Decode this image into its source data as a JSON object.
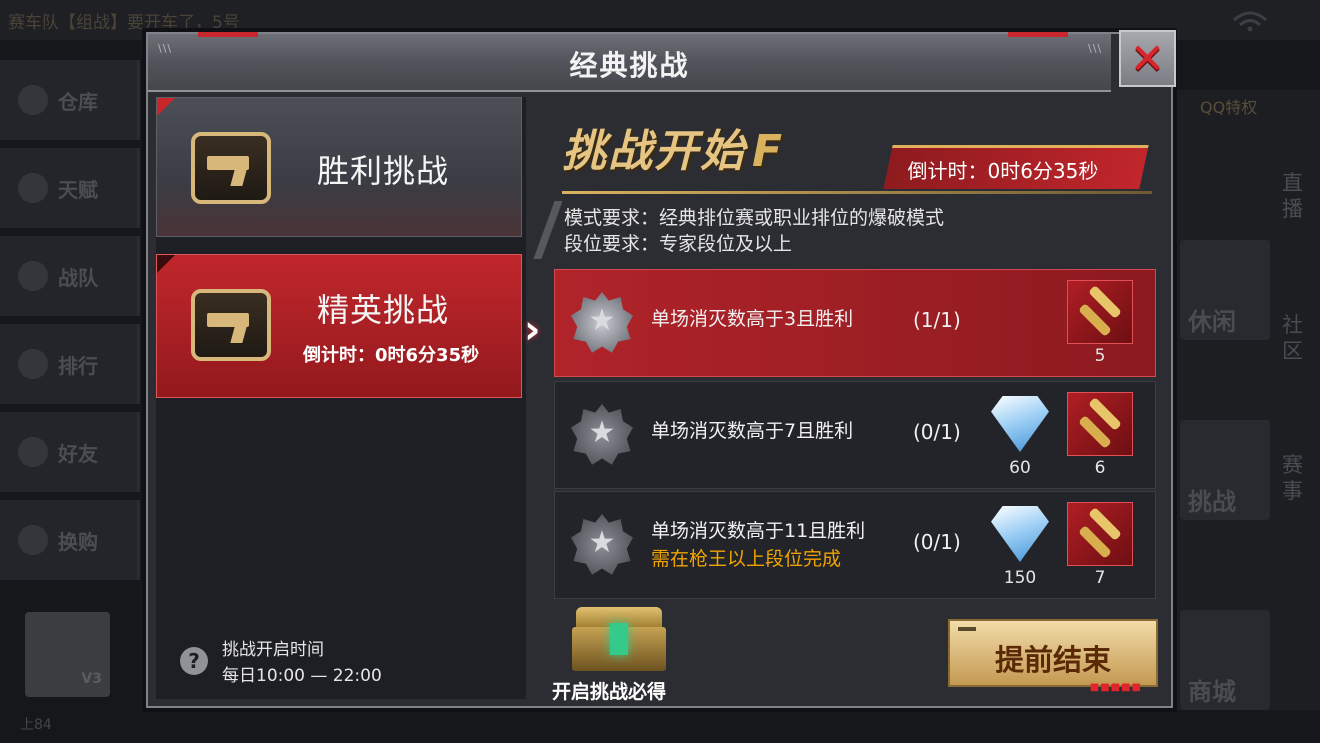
{
  "background": {
    "ticker": "赛车队【组战】要开车了，5号",
    "side_items": [
      "仓库",
      "天赋",
      "战队",
      "排行",
      "好友",
      "换购"
    ],
    "right_top": "QQ特权",
    "right_vertical": [
      "直播",
      "社区",
      "赛事"
    ],
    "right_blocks": [
      "休闲",
      "挑战",
      "商城"
    ],
    "avatar_badge": "V3",
    "rank_text": "上84"
  },
  "dialog": {
    "title": "经典挑战",
    "close_icon": "close-x-icon"
  },
  "tabs": [
    {
      "label": "胜利挑战",
      "icon": "pistol-crate-icon",
      "selected": false
    },
    {
      "label": "精英挑战",
      "icon": "pistol-crate-icon",
      "selected": true,
      "countdown": "倒计时：0时6分35秒"
    }
  ],
  "help": {
    "icon": "question-icon",
    "title": "挑战开启时间",
    "hours": "每日10:00 — 22:00"
  },
  "challenge": {
    "banner": "挑战开始",
    "banner_mark": "F",
    "countdown": "倒计时：0时6分35秒",
    "mode_requirement": "模式要求：经典排位赛或职业排位的爆破模式",
    "rank_requirement": "段位要求：专家段位及以上"
  },
  "tasks": [
    {
      "text": "单场消灭数高于3且胜利",
      "progress": "(1/1)",
      "completed": true,
      "rewards": [
        {
          "type": "ammo",
          "icon": "bullets-icon",
          "qty": "5"
        }
      ]
    },
    {
      "text": "单场消灭数高于7且胜利",
      "progress": "(0/1)",
      "completed": false,
      "rewards": [
        {
          "type": "diamond",
          "icon": "diamond-icon",
          "qty": "60"
        },
        {
          "type": "ammo",
          "icon": "bullets-icon",
          "qty": "6"
        }
      ]
    },
    {
      "text": "单场消灭数高于11且胜利",
      "note": "需在枪王以上段位完成",
      "progress": "(0/1)",
      "completed": false,
      "rewards": [
        {
          "type": "diamond",
          "icon": "diamond-icon",
          "qty": "150"
        },
        {
          "type": "ammo",
          "icon": "bullets-icon",
          "qty": "7"
        }
      ]
    }
  ],
  "chest": {
    "icon": "treasure-chest-icon",
    "label": "开启挑战必得"
  },
  "end_button": {
    "label": "提前结束"
  },
  "colors": {
    "accent_red": "#c1262c",
    "gold": "#d9b260",
    "note_orange": "#f0a400"
  }
}
